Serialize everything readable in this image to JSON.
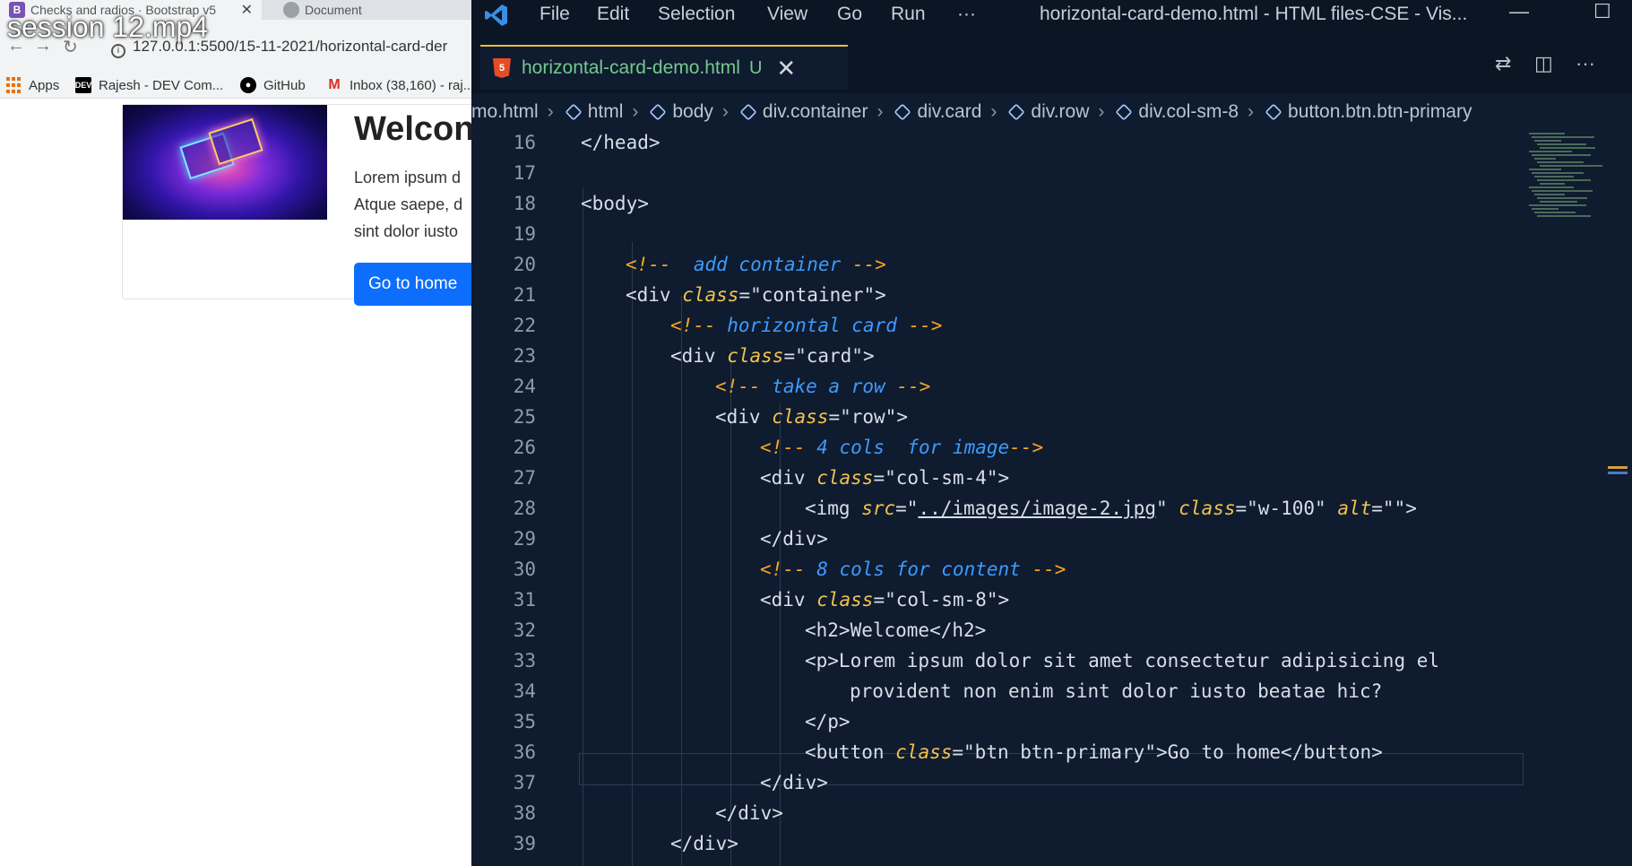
{
  "video": {
    "overlay_title": "session 12.mp4"
  },
  "browser": {
    "tabs": [
      {
        "title": "Checks and radios · Bootstrap v5",
        "favicon": "B"
      },
      {
        "title": "Document"
      }
    ],
    "tab_close": "✕",
    "address": "127.0.0.1:5500/15-11-2021/horizontal-card-der",
    "bookmarks": [
      "Apps",
      "Rajesh - DEV Com...",
      "GitHub",
      "Inbox (38,160) - raj..."
    ],
    "card": {
      "title": "Welcon",
      "text_lines": [
        "Lorem ipsum d",
        "Atque saepe, d",
        "sint dolor iusto"
      ],
      "button": "Go to home"
    }
  },
  "vscode": {
    "menu": [
      "File",
      "Edit",
      "Selection",
      "View",
      "Go",
      "Run",
      "···"
    ],
    "window_title": "horizontal-card-demo.html - HTML files-CSE - Vis...",
    "tab": {
      "name": "horizontal-card-demo.html",
      "status": "U",
      "close": "✕"
    },
    "breadcrumb": [
      "mo.html",
      "html",
      "body",
      "div.container",
      "div.card",
      "div.row",
      "div.col-sm-8",
      "button.btn.btn-primary"
    ],
    "lines": [
      {
        "n": "16",
        "indent": 0,
        "tokens": [
          [
            "t",
            "</head>"
          ]
        ]
      },
      {
        "n": "17",
        "indent": 0,
        "tokens": []
      },
      {
        "n": "18",
        "indent": 0,
        "tokens": [
          [
            "t",
            "<body>"
          ]
        ]
      },
      {
        "n": "19",
        "indent": 0,
        "tokens": []
      },
      {
        "n": "20",
        "indent": 1,
        "tokens": [
          [
            "cd",
            "<!-- "
          ],
          [
            "c",
            " add container "
          ],
          [
            "cd",
            "-->"
          ]
        ]
      },
      {
        "n": "21",
        "indent": 1,
        "tokens": [
          [
            "t",
            "<div "
          ],
          [
            "a",
            "class"
          ],
          [
            "t",
            "="
          ],
          [
            "s",
            "\"container\""
          ],
          [
            "t",
            ">"
          ]
        ]
      },
      {
        "n": "22",
        "indent": 2,
        "tokens": [
          [
            "cd",
            "<!-- "
          ],
          [
            "c",
            "horizontal card "
          ],
          [
            "cd",
            "-->"
          ]
        ]
      },
      {
        "n": "23",
        "indent": 2,
        "tokens": [
          [
            "t",
            "<div "
          ],
          [
            "a",
            "class"
          ],
          [
            "t",
            "="
          ],
          [
            "s",
            "\"card\""
          ],
          [
            "t",
            ">"
          ]
        ]
      },
      {
        "n": "24",
        "indent": 3,
        "tokens": [
          [
            "cd",
            "<!-- "
          ],
          [
            "c",
            "take a row "
          ],
          [
            "cd",
            "-->"
          ]
        ]
      },
      {
        "n": "25",
        "indent": 3,
        "tokens": [
          [
            "t",
            "<div "
          ],
          [
            "a",
            "class"
          ],
          [
            "t",
            "="
          ],
          [
            "s",
            "\"row\""
          ],
          [
            "t",
            ">"
          ]
        ]
      },
      {
        "n": "26",
        "indent": 4,
        "tokens": [
          [
            "cd",
            "<!-- "
          ],
          [
            "c",
            "4 cols  for image"
          ],
          [
            "cd",
            "-->"
          ]
        ]
      },
      {
        "n": "27",
        "indent": 4,
        "tokens": [
          [
            "t",
            "<div "
          ],
          [
            "a",
            "class"
          ],
          [
            "t",
            "="
          ],
          [
            "s",
            "\"col-sm-4\""
          ],
          [
            "t",
            ">"
          ]
        ]
      },
      {
        "n": "28",
        "indent": 5,
        "tokens": [
          [
            "t",
            "<img "
          ],
          [
            "a",
            "src"
          ],
          [
            "t",
            "=\""
          ],
          [
            "l",
            "../images/image-2.jpg"
          ],
          [
            "t",
            "\" "
          ],
          [
            "a",
            "class"
          ],
          [
            "t",
            "="
          ],
          [
            "s",
            "\"w-100\""
          ],
          [
            "t",
            " "
          ],
          [
            "a",
            "alt"
          ],
          [
            "t",
            "="
          ],
          [
            "s",
            "\"\""
          ],
          [
            "t",
            ">"
          ]
        ]
      },
      {
        "n": "29",
        "indent": 4,
        "tokens": [
          [
            "t",
            "</div>"
          ]
        ]
      },
      {
        "n": "30",
        "indent": 4,
        "tokens": [
          [
            "cd",
            "<!-- "
          ],
          [
            "c",
            "8 cols for content "
          ],
          [
            "cd",
            "-->"
          ]
        ]
      },
      {
        "n": "31",
        "indent": 4,
        "tokens": [
          [
            "t",
            "<div "
          ],
          [
            "a",
            "class"
          ],
          [
            "t",
            "="
          ],
          [
            "s",
            "\"col-sm-8\""
          ],
          [
            "t",
            ">"
          ]
        ]
      },
      {
        "n": "32",
        "indent": 5,
        "tokens": [
          [
            "t",
            "<h2>Welcome</h2>"
          ]
        ]
      },
      {
        "n": "33",
        "indent": 5,
        "tokens": [
          [
            "t",
            "<p>Lorem ipsum dolor sit amet consectetur adipisicing el"
          ]
        ]
      },
      {
        "n": "34",
        "indent": 6,
        "tokens": [
          [
            "t",
            "provident non enim sint dolor iusto beatae hic?"
          ]
        ]
      },
      {
        "n": "35",
        "indent": 5,
        "tokens": [
          [
            "t",
            "</p>"
          ]
        ]
      },
      {
        "n": "36",
        "indent": 5,
        "tokens": [
          [
            "t",
            "<button "
          ],
          [
            "a",
            "class"
          ],
          [
            "t",
            "="
          ],
          [
            "s",
            "\"btn btn-primary\""
          ],
          [
            "t",
            ">Go to home</button>"
          ]
        ]
      },
      {
        "n": "37",
        "indent": 4,
        "tokens": [
          [
            "t",
            "</div>"
          ]
        ]
      },
      {
        "n": "38",
        "indent": 3,
        "tokens": [
          [
            "t",
            "</div>"
          ]
        ]
      },
      {
        "n": "39",
        "indent": 2,
        "tokens": [
          [
            "t",
            "</div>"
          ]
        ]
      }
    ],
    "colors": {
      "background": "#0f1b2e",
      "comment_delimiter": "#f5a623",
      "comment_text": "#3c9bff",
      "attribute": "#f2c14e",
      "tab_name": "#73c991"
    }
  }
}
